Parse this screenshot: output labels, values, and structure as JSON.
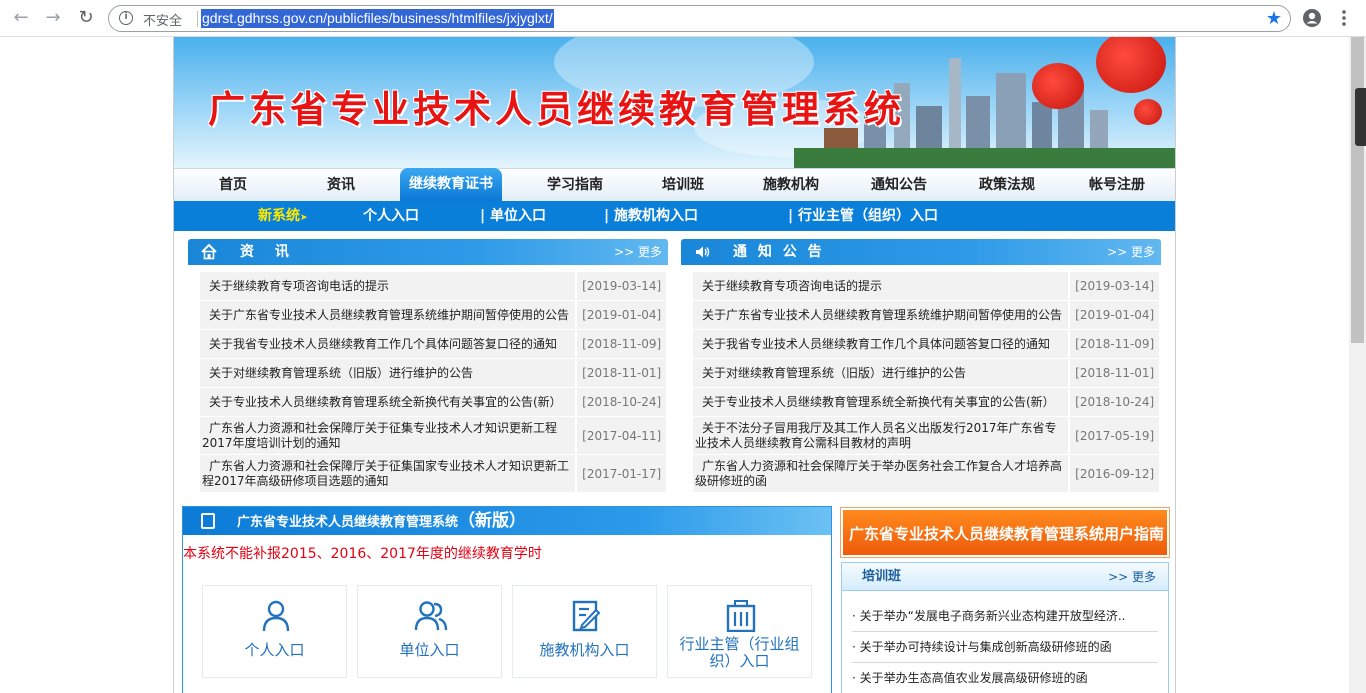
{
  "browser": {
    "insecure_label": "不安全",
    "url": "gdrst.gdhrss.gov.cn/publicfiles/business/htmlfiles/jxjyglxt/"
  },
  "banner": {
    "title": "广东省专业技术人员继续教育管理系统"
  },
  "main_nav": [
    {
      "label": "首页"
    },
    {
      "label": "资讯"
    },
    {
      "label": "继续教育证书"
    },
    {
      "label": "学习指南"
    },
    {
      "label": "培训班"
    },
    {
      "label": "施教机构"
    },
    {
      "label": "通知公告"
    },
    {
      "label": "政策法规"
    },
    {
      "label": "帐号注册"
    }
  ],
  "sub_nav": [
    {
      "label": "新系统"
    },
    {
      "label": "个人入口"
    },
    {
      "label": "| 单位入口"
    },
    {
      "label": "| 施教机构入口"
    },
    {
      "label": "| 行业主管（组织）入口"
    }
  ],
  "news_panel": {
    "title": "资 讯",
    "more": ">> 更多",
    "items": [
      {
        "title": "关于继续教育专项咨询电话的提示",
        "date": "[2019-03-14]"
      },
      {
        "title": "关于广东省专业技术人员继续教育管理系统维护期间暂停使用的公告",
        "date": "[2019-01-04]"
      },
      {
        "title": "关于我省专业技术人员继续教育工作几个具体问题答复口径的通知",
        "date": "[2018-11-09]"
      },
      {
        "title": "关于对继续教育管理系统（旧版）进行维护的公告",
        "date": "[2018-11-01]"
      },
      {
        "title": "关于专业技术人员继续教育管理系统全新换代有关事宜的公告(新）",
        "date": "[2018-10-24]"
      },
      {
        "title": "广东省人力资源和社会保障厅关于征集专业技术人才知识更新工程2017年度培训计划的通知",
        "date": "[2017-04-11]"
      },
      {
        "title": "广东省人力资源和社会保障厅关于征集国家专业技术人才知识更新工程2017年高级研修项目选题的通知",
        "date": "[2017-01-17]"
      }
    ]
  },
  "notice_panel": {
    "title": "通 知 公 告",
    "more": ">> 更多",
    "items": [
      {
        "title": "关于继续教育专项咨询电话的提示",
        "date": "[2019-03-14]"
      },
      {
        "title": "关于广东省专业技术人员继续教育管理系统维护期间暂停使用的公告",
        "date": "[2019-01-04]"
      },
      {
        "title": "关于我省专业技术人员继续教育工作几个具体问题答复口径的通知",
        "date": "[2018-11-09]"
      },
      {
        "title": "关于对继续教育管理系统（旧版）进行维护的公告",
        "date": "[2018-11-01]"
      },
      {
        "title": "关于专业技术人员继续教育管理系统全新换代有关事宜的公告(新）",
        "date": "[2018-10-24]"
      },
      {
        "title": "关于不法分子冒用我厅及其工作人员名义出版发行2017年广东省专业技术人员继续教育公需科目教材的声明",
        "date": "[2017-05-19]"
      },
      {
        "title": "广东省人力资源和社会保障厅关于举办医务社会工作复合人才培养高级研修班的函",
        "date": "[2016-09-12]"
      }
    ]
  },
  "system_box": {
    "title": "广东省专业技术人员继续教育管理系统",
    "title_new": "（新版）",
    "warning": "本系统不能补报2015、2016、2017年度的继续教育学时",
    "entries": [
      {
        "label": "个人入口",
        "icon": "person-icon"
      },
      {
        "label": "单位入口",
        "icon": "group-icon"
      },
      {
        "label": "施教机构入口",
        "icon": "edit-doc-icon"
      },
      {
        "label": "行业主管（行业组织）入口",
        "icon": "building-icon"
      }
    ]
  },
  "guide_banner": {
    "label": "广东省专业技术人员继续教育管理系统用户指南"
  },
  "training_box": {
    "title": "培训班",
    "more": ">> 更多",
    "items": [
      {
        "title": "· 关于举办“发展电子商务新兴业态构建开放型经济.."
      },
      {
        "title": "· 关于举办可持续设计与集成创新高级研修班的函"
      },
      {
        "title": "· 关于举办生态高值农业发展高级研修班的函"
      }
    ]
  },
  "colors": {
    "nav_blue": "#0a7fd9",
    "title_red": "#e81413",
    "warning_red": "#e60012",
    "guide_orange": "#ee5b0b"
  }
}
